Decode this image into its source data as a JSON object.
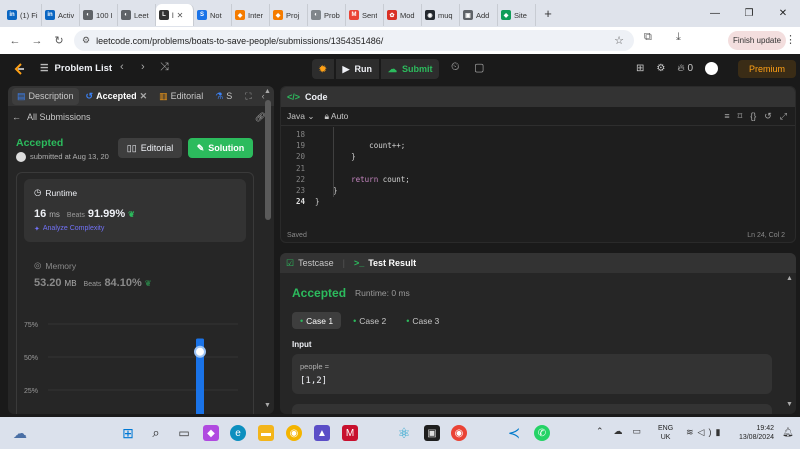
{
  "browser": {
    "tabs": [
      {
        "label": "(1) Fi",
        "icon": "linkedin-icon",
        "color": "#0a66c2",
        "glyph": "in"
      },
      {
        "label": "Activ",
        "icon": "linkedin-icon",
        "color": "#0a66c2",
        "glyph": "in"
      },
      {
        "label": "100 I",
        "icon": "globe-icon",
        "color": "#5f6368",
        "glyph": "◐"
      },
      {
        "label": "Leet",
        "icon": "globe-icon",
        "color": "#5f6368",
        "glyph": "◐"
      },
      {
        "label": "l",
        "icon": "leetcode-icon",
        "color": "#333333",
        "glyph": "L",
        "active": true,
        "close": "✕"
      },
      {
        "label": "Not",
        "icon": "s-icon",
        "color": "#1a73e8",
        "glyph": "S"
      },
      {
        "label": "Inter",
        "icon": "orange-icon",
        "color": "#f57c00",
        "glyph": "◆"
      },
      {
        "label": "Proj",
        "icon": "orange-icon",
        "color": "#f57c00",
        "glyph": "◆"
      },
      {
        "label": "Prob",
        "icon": "globe-icon",
        "color": "#80868b",
        "glyph": "◐"
      },
      {
        "label": "Sent",
        "icon": "gmail-icon",
        "color": "#ea4335",
        "glyph": "M"
      },
      {
        "label": "Mod",
        "icon": "red-icon",
        "color": "#d93025",
        "glyph": "✿"
      },
      {
        "label": "muq",
        "icon": "github-icon",
        "color": "#24292f",
        "glyph": "◉"
      },
      {
        "label": "Add",
        "icon": "doc-icon",
        "color": "#5f6368",
        "glyph": "▣"
      },
      {
        "label": "Site",
        "icon": "site-icon",
        "color": "#0f9d58",
        "glyph": "◆"
      }
    ],
    "new_tab": "+",
    "url": "leetcode.com/problems/boats-to-save-people/submissions/1354351486/",
    "update_label": "Finish update"
  },
  "nav": {
    "problem_list": "Problem List",
    "run": "Run",
    "submit": "Submit",
    "streak": "0",
    "premium": "Premium"
  },
  "left": {
    "tabs": [
      "Description",
      "Accepted",
      "Editorial",
      "S"
    ],
    "all_submissions": "All Submissions",
    "status": "Accepted",
    "submitted_at": "submitted at Aug 13, 20",
    "editorial_btn": "Editorial",
    "solution_btn": "Solution",
    "runtime": {
      "label": "Runtime",
      "value": "16",
      "unit": "ms",
      "beats_label": "Beats",
      "beats_pct": "91.99%",
      "analyze": "Analyze Complexity"
    },
    "memory": {
      "label": "Memory",
      "value": "53.20",
      "unit": "MB",
      "beats_label": "Beats",
      "beats_pct": "84.10%"
    }
  },
  "chart_data": {
    "type": "bar",
    "yticks": [
      "75%",
      "50%",
      "25%"
    ],
    "ylim": [
      0,
      100
    ],
    "bars": [
      {
        "value": 64,
        "highlight": true
      },
      {
        "value": 6,
        "highlight": false
      }
    ],
    "marker_value": 54,
    "grid": true
  },
  "code": {
    "title": "Code",
    "language": "Java",
    "mode": "Auto",
    "lines": [
      {
        "n": "18",
        "text": ""
      },
      {
        "n": "19",
        "text": "            count++;"
      },
      {
        "n": "20",
        "text": "        }"
      },
      {
        "n": "21",
        "text": ""
      },
      {
        "n": "22",
        "text": "        return count;"
      },
      {
        "n": "23",
        "text": "    }"
      },
      {
        "n": "24",
        "text": "}"
      }
    ],
    "status": "Saved",
    "position": "Ln 24, Col 2"
  },
  "result": {
    "testcase_tab": "Testcase",
    "result_tab": "Test Result",
    "status": "Accepted",
    "runtime": "Runtime: 0 ms",
    "cases": [
      "Case 1",
      "Case 2",
      "Case 3"
    ],
    "input_label": "Input",
    "var_name": "people =",
    "var_value": "[1,2]"
  },
  "taskbar": {
    "lang_top": "ENG",
    "lang_bottom": "UK",
    "time": "19:42",
    "date": "13/08/2024"
  }
}
